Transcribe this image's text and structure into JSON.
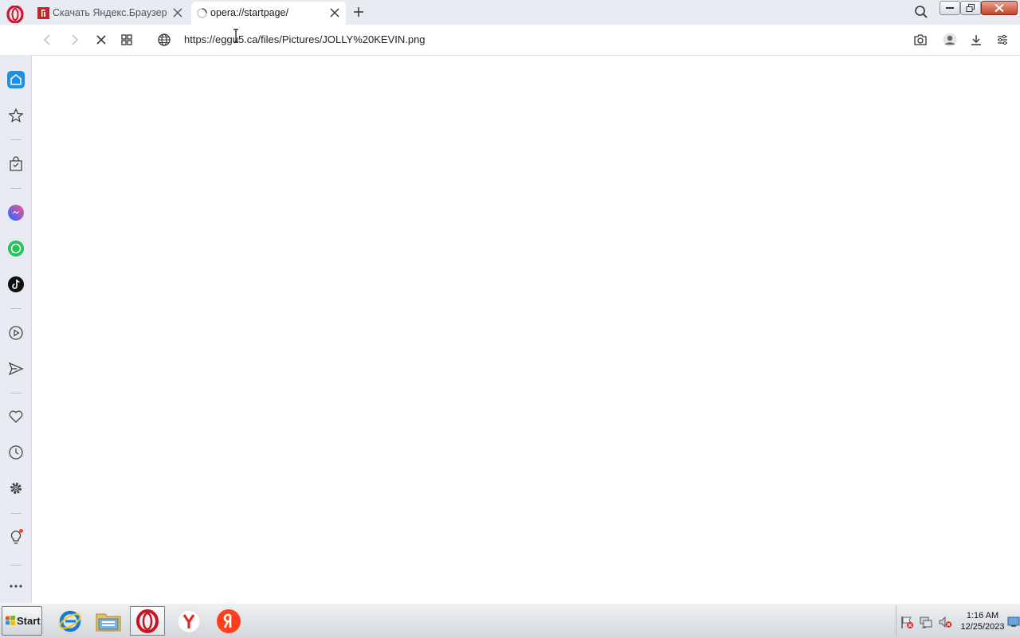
{
  "tabs": [
    {
      "title": "Скачать Яндекс.Браузер",
      "active": false
    },
    {
      "title": "opera://startpage/",
      "active": true
    }
  ],
  "address_bar": {
    "url": "https://eggu5.ca/files/Pictures/JOLLY%20KEVIN.png",
    "loading": true
  },
  "sidebar": {
    "items": [
      "home-icon",
      "star-icon",
      "bag-icon",
      "messenger-icon",
      "whatsapp-icon",
      "tiktok-icon",
      "player-icon",
      "send-icon",
      "heart-icon",
      "history-icon",
      "settings-icon",
      "lightbulb-icon",
      "more-icon"
    ]
  },
  "taskbar": {
    "start_label": "Start",
    "apps": [
      "internet-explorer",
      "file-explorer",
      "opera",
      "yandex-browser",
      "yandex"
    ]
  },
  "clock": {
    "time": "1:16 AM",
    "date": "12/25/2023"
  },
  "colors": {
    "accent": "#1d8fe8",
    "opera_red": "#cc1122",
    "yandex_red": "#fc3f1d"
  }
}
